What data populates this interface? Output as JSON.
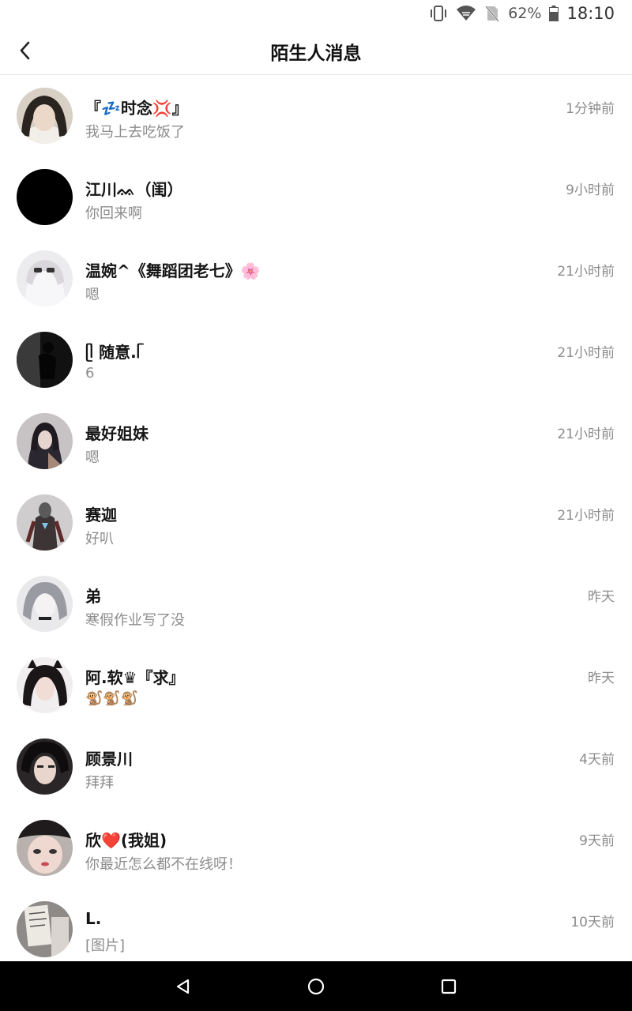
{
  "status_bar": {
    "battery": "62%",
    "time": "18:10",
    "icons": [
      "vibrate-icon",
      "wifi-icon",
      "no-sim-icon",
      "battery-icon"
    ]
  },
  "header": {
    "title": "陌生人消息",
    "back_icon": "chevron-left-icon"
  },
  "conversations": [
    {
      "name": "『💤时念💢』",
      "preview": "我马上去吃饭了",
      "time": "1分钟前"
    },
    {
      "name": "江川ᨐ（闺）",
      "preview": "你回来啊",
      "time": "9小时前"
    },
    {
      "name": "温婉^《舞蹈团老七》🌸",
      "preview": "嗯",
      "time": "21小时前"
    },
    {
      "name": "ᥫ 随意.ᥬ",
      "preview": "6",
      "time": "21小时前"
    },
    {
      "name": "最好姐妹",
      "preview": "嗯",
      "time": "21小时前"
    },
    {
      "name": "赛迦",
      "preview": "好叭",
      "time": "21小时前"
    },
    {
      "name": "弟",
      "preview": "寒假作业写了没",
      "time": "昨天"
    },
    {
      "name": "阿.软♛『求』",
      "preview": "🐒🐒🐒",
      "time": "昨天"
    },
    {
      "name": "顾景川",
      "preview": "拜拜",
      "time": "4天前"
    },
    {
      "name": "欣❤️(我姐)",
      "preview": "你最近怎么都不在线呀！",
      "time": "9天前"
    },
    {
      "name": "L.",
      "preview": "[图片]",
      "time": "10天前"
    }
  ],
  "nav_bar": {
    "icons": [
      "back-triangle-icon",
      "home-circle-icon",
      "recents-square-icon"
    ]
  }
}
